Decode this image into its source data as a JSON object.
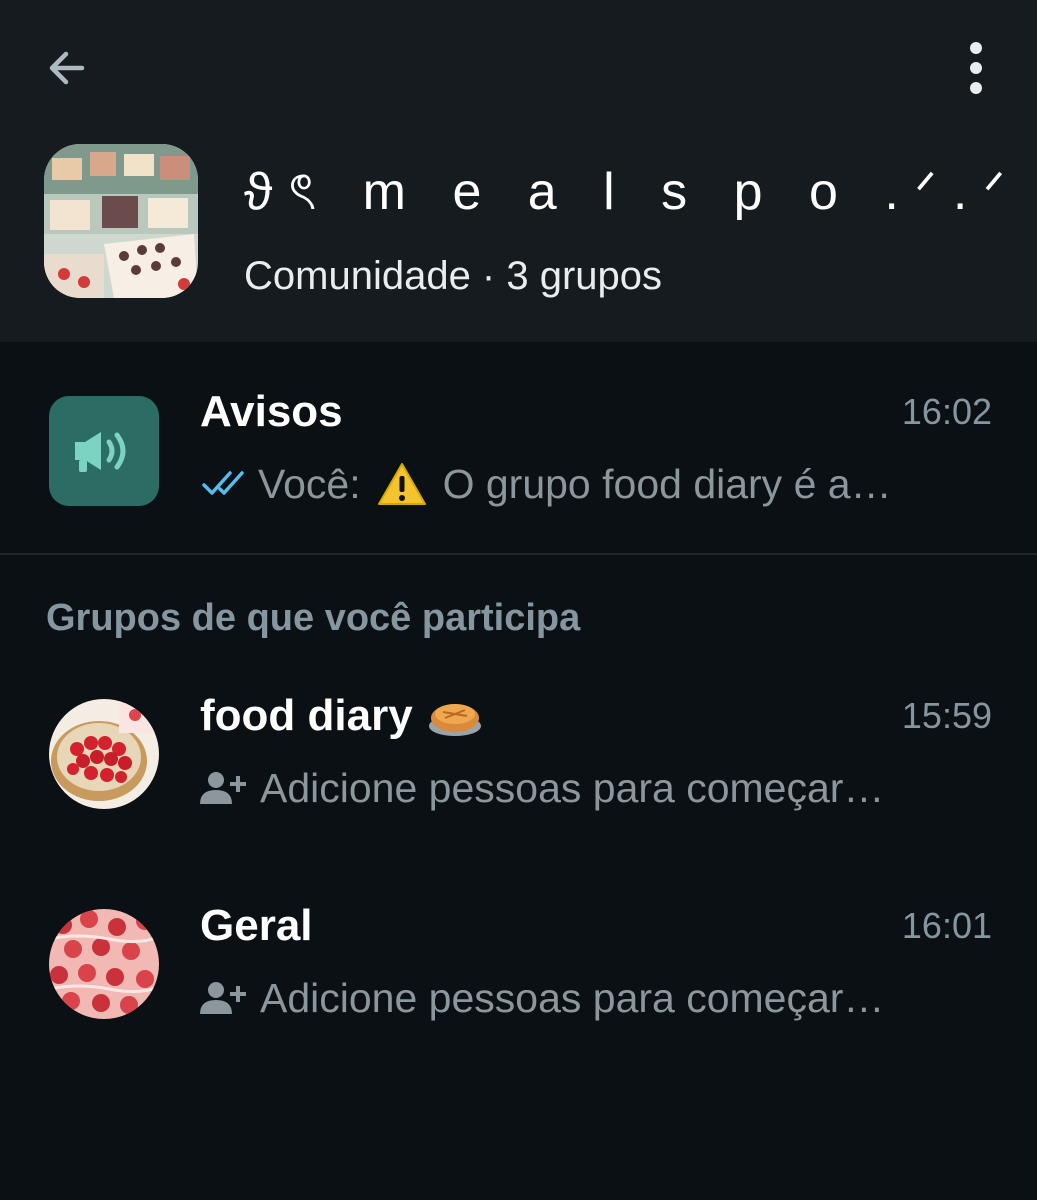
{
  "header": {
    "community_name": "ϑৎ m e a l s p o .ᐟ.ᐟ",
    "community_subtitle": "Comunidade · 3 grupos"
  },
  "announcements": {
    "title": "Avisos",
    "time": "16:02",
    "sender": "Você:",
    "preview": "O grupo food diary é a…"
  },
  "section": {
    "label": "Grupos de que você participa"
  },
  "groups": [
    {
      "title": "food diary",
      "time": "15:59",
      "preview": "Adicione pessoas para começar…"
    },
    {
      "title": "Geral",
      "time": "16:01",
      "preview": "Adicione pessoas para começar…"
    }
  ],
  "colors": {
    "background": "#0b1014",
    "header_bg": "#161b1f",
    "accent_teal": "#2b6d64",
    "read_ticks": "#53bdeb",
    "muted_text": "#8696a0"
  },
  "icons": {
    "back": "arrow-left-icon",
    "more": "more-vertical-icon",
    "announcement": "megaphone-icon",
    "read": "double-check-icon",
    "warning": "warning-icon",
    "add_person": "add-person-icon",
    "pie": "pie-emoji-icon"
  }
}
